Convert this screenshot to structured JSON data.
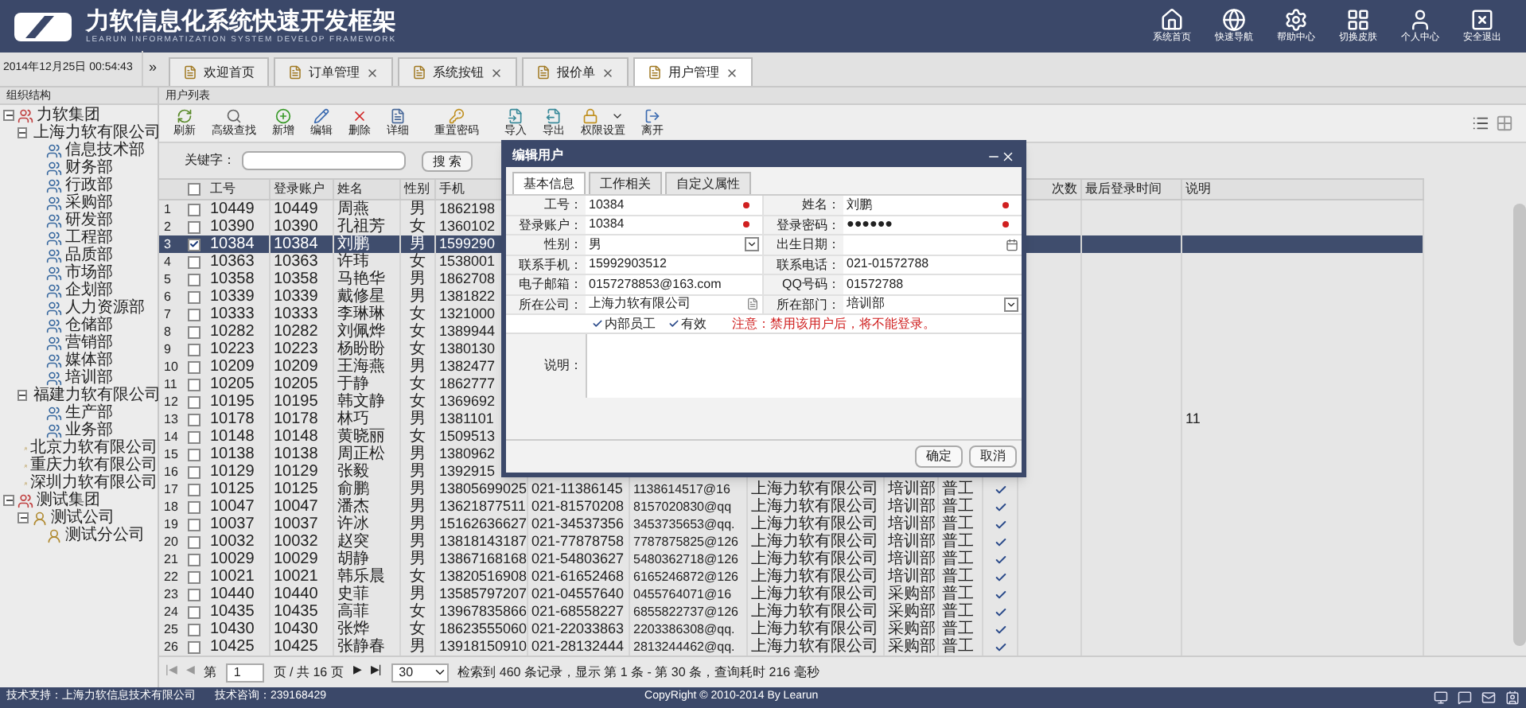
{
  "header": {
    "title": "力软信息化系统快速开发框架",
    "subtitle": "LEARUN INFORMATIZATION SYSTEM DEVELOP FRAMEWORK",
    "nav": [
      "系统首页",
      "快速导航",
      "帮助中心",
      "切换皮肤",
      "个人中心",
      "安全退出"
    ]
  },
  "datetime": "2014年12月25日 00:54:43",
  "tab_more": "»",
  "tabs": [
    {
      "label": "欢迎首页",
      "selected": false,
      "closable": false
    },
    {
      "label": "订单管理",
      "selected": false,
      "closable": true
    },
    {
      "label": "系统按钮",
      "selected": false,
      "closable": true
    },
    {
      "label": "报价单",
      "selected": false,
      "closable": true
    },
    {
      "label": "用户管理",
      "selected": true,
      "closable": true
    }
  ],
  "sidebar": {
    "title": "组织结构",
    "tree": [
      {
        "label": "力软集团",
        "kind": "group",
        "expanded": true,
        "children": [
          {
            "label": "上海力软有限公司",
            "kind": "company",
            "expanded": true,
            "children": [
              {
                "label": "信息技术部",
                "kind": "dept"
              },
              {
                "label": "财务部",
                "kind": "dept"
              },
              {
                "label": "行政部",
                "kind": "dept"
              },
              {
                "label": "采购部",
                "kind": "dept"
              },
              {
                "label": "研发部",
                "kind": "dept"
              },
              {
                "label": "工程部",
                "kind": "dept"
              },
              {
                "label": "品质部",
                "kind": "dept"
              },
              {
                "label": "市场部",
                "kind": "dept"
              },
              {
                "label": "企划部",
                "kind": "dept"
              },
              {
                "label": "人力资源部",
                "kind": "dept"
              },
              {
                "label": "仓储部",
                "kind": "dept"
              },
              {
                "label": "营销部",
                "kind": "dept"
              },
              {
                "label": "媒体部",
                "kind": "dept"
              },
              {
                "label": "培训部",
                "kind": "dept"
              }
            ]
          },
          {
            "label": "福建力软有限公司",
            "kind": "company",
            "expanded": true,
            "children": [
              {
                "label": "生产部",
                "kind": "dept"
              },
              {
                "label": "业务部",
                "kind": "dept"
              }
            ]
          },
          {
            "label": "北京力软有限公司",
            "kind": "company"
          },
          {
            "label": "重庆力软有限公司",
            "kind": "company"
          },
          {
            "label": "深圳力软有限公司",
            "kind": "company"
          }
        ]
      },
      {
        "label": "测试集团",
        "kind": "group",
        "expanded": true,
        "children": [
          {
            "label": "测试公司",
            "kind": "company",
            "expanded": true,
            "children": [
              {
                "label": "测试分公司",
                "kind": "company"
              }
            ]
          }
        ]
      }
    ]
  },
  "panel_title": "用户列表",
  "toolbar": [
    {
      "label": "刷新",
      "dropdown": false
    },
    {
      "label": "高级查找",
      "dropdown": false
    },
    {
      "label": "新增",
      "dropdown": false
    },
    {
      "label": "编辑",
      "dropdown": false
    },
    {
      "label": "删除",
      "dropdown": false
    },
    {
      "label": "详细",
      "dropdown": false
    },
    {
      "label": "重置密码",
      "dropdown": false
    },
    {
      "label": "导入",
      "dropdown": false
    },
    {
      "label": "导出",
      "dropdown": false
    },
    {
      "label": "权限设置",
      "dropdown": true
    },
    {
      "label": "离开",
      "dropdown": false
    }
  ],
  "search": {
    "label": "关键字：",
    "button": "搜 索"
  },
  "table": {
    "select_all": false,
    "columns": [
      "工号",
      "登录账户",
      "姓名",
      "性别",
      "手机"
    ],
    "right_columns": [
      "次数",
      "最后登录时间",
      "说明"
    ],
    "rows": [
      {
        "n": "1",
        "checked": false,
        "selected": false,
        "cells": [
          "10449",
          "10449",
          "周燕",
          "男",
          "1862198"
        ]
      },
      {
        "n": "2",
        "checked": false,
        "selected": false,
        "cells": [
          "10390",
          "10390",
          "孔祖芳",
          "女",
          "1360102"
        ]
      },
      {
        "n": "3",
        "checked": true,
        "selected": true,
        "cells": [
          "10384",
          "10384",
          "刘鹏",
          "男",
          "1599290"
        ]
      },
      {
        "n": "4",
        "checked": false,
        "selected": false,
        "cells": [
          "10363",
          "10363",
          "许玮",
          "女",
          "1538001"
        ]
      },
      {
        "n": "5",
        "checked": false,
        "selected": false,
        "cells": [
          "10358",
          "10358",
          "马艳华",
          "男",
          "1862708"
        ]
      },
      {
        "n": "6",
        "checked": false,
        "selected": false,
        "cells": [
          "10339",
          "10339",
          "戴修星",
          "男",
          "1381822"
        ]
      },
      {
        "n": "7",
        "checked": false,
        "selected": false,
        "cells": [
          "10333",
          "10333",
          "李琳琳",
          "女",
          "1321000"
        ]
      },
      {
        "n": "8",
        "checked": false,
        "selected": false,
        "cells": [
          "10282",
          "10282",
          "刘佩烨",
          "女",
          "1389944"
        ]
      },
      {
        "n": "9",
        "checked": false,
        "selected": false,
        "cells": [
          "10223",
          "10223",
          "杨盼盼",
          "女",
          "1380130"
        ]
      },
      {
        "n": "10",
        "checked": false,
        "selected": false,
        "cells": [
          "10209",
          "10209",
          "王海燕",
          "男",
          "1382477"
        ]
      },
      {
        "n": "11",
        "checked": false,
        "selected": false,
        "cells": [
          "10205",
          "10205",
          "于静",
          "女",
          "1862777"
        ]
      },
      {
        "n": "12",
        "checked": false,
        "selected": false,
        "cells": [
          "10195",
          "10195",
          "韩文静",
          "女",
          "1369692"
        ]
      },
      {
        "n": "13",
        "checked": false,
        "selected": false,
        "cells": [
          "10178",
          "10178",
          "林巧",
          "男",
          "1381101"
        ],
        "note": "11"
      },
      {
        "n": "14",
        "checked": false,
        "selected": false,
        "cells": [
          "10148",
          "10148",
          "黄晓丽",
          "女",
          "1509513"
        ]
      },
      {
        "n": "15",
        "checked": false,
        "selected": false,
        "cells": [
          "10138",
          "10138",
          "周正松",
          "男",
          "1380962"
        ]
      },
      {
        "n": "16",
        "checked": false,
        "selected": false,
        "cells": [
          "10129",
          "10129",
          "张毅",
          "男",
          "1392915"
        ]
      },
      {
        "n": "17",
        "checked": false,
        "selected": false,
        "valid": true,
        "cells": [
          "10125",
          "10125",
          "俞鹏",
          "男",
          "13805699025",
          "021-11386145",
          "1138614517@16",
          "上海力软有限公司",
          "培训部",
          "普工"
        ]
      },
      {
        "n": "18",
        "checked": false,
        "selected": false,
        "valid": true,
        "cells": [
          "10047",
          "10047",
          "潘杰",
          "男",
          "13621877511",
          "021-81570208",
          "8157020830@qq",
          "上海力软有限公司",
          "培训部",
          "普工"
        ]
      },
      {
        "n": "19",
        "checked": false,
        "selected": false,
        "valid": true,
        "cells": [
          "10037",
          "10037",
          "许冰",
          "男",
          "15162636627",
          "021-34537356",
          "3453735653@qq.",
          "上海力软有限公司",
          "培训部",
          "普工"
        ]
      },
      {
        "n": "20",
        "checked": false,
        "selected": false,
        "valid": true,
        "cells": [
          "10032",
          "10032",
          "赵突",
          "男",
          "13818143187",
          "021-77878758",
          "7787875825@126",
          "上海力软有限公司",
          "培训部",
          "普工"
        ]
      },
      {
        "n": "21",
        "checked": false,
        "selected": false,
        "valid": true,
        "cells": [
          "10029",
          "10029",
          "胡静",
          "男",
          "13867168168",
          "021-54803627",
          "5480362718@126",
          "上海力软有限公司",
          "培训部",
          "普工"
        ]
      },
      {
        "n": "22",
        "checked": false,
        "selected": false,
        "valid": true,
        "cells": [
          "10021",
          "10021",
          "韩乐晨",
          "女",
          "13820516908",
          "021-61652468",
          "6165246872@126",
          "上海力软有限公司",
          "培训部",
          "普工"
        ]
      },
      {
        "n": "23",
        "checked": false,
        "selected": false,
        "valid": true,
        "cells": [
          "10440",
          "10440",
          "史菲",
          "男",
          "13585797207",
          "021-04557640",
          "0455764071@16",
          "上海力软有限公司",
          "采购部",
          "普工"
        ]
      },
      {
        "n": "24",
        "checked": false,
        "selected": false,
        "valid": true,
        "cells": [
          "10435",
          "10435",
          "高菲",
          "女",
          "13967835866",
          "021-68558227",
          "6855822737@126",
          "上海力软有限公司",
          "采购部",
          "普工"
        ]
      },
      {
        "n": "25",
        "checked": false,
        "selected": false,
        "valid": true,
        "cells": [
          "10430",
          "10430",
          "张烨",
          "女",
          "18623555060",
          "021-22033863",
          "2203386308@qq.",
          "上海力软有限公司",
          "采购部",
          "普工"
        ]
      },
      {
        "n": "26",
        "checked": false,
        "selected": false,
        "valid": true,
        "cells": [
          "10425",
          "10425",
          "张静春",
          "男",
          "13918150910",
          "021-28132444",
          "2813244462@qq.",
          "上海力软有限公司",
          "采购部",
          "普工"
        ]
      }
    ]
  },
  "pager": {
    "first": "|◀",
    "prev": "◀",
    "before": "第",
    "page": "1",
    "after": "页 / 共 16 页",
    "next": "▶",
    "last": "▶|",
    "size": "30",
    "summary": "检索到 460 条记录，显示 第 1 条 - 第 30 条，查询耗时 216 毫秒"
  },
  "dialog": {
    "title": "编辑用户",
    "tabs": [
      {
        "label": "基本信息",
        "selected": true
      },
      {
        "label": "工作相关",
        "selected": false
      },
      {
        "label": "自定义属性",
        "selected": false
      }
    ],
    "fields": [
      {
        "label": "工号：",
        "value": "10384",
        "kind": "text",
        "required": true
      },
      {
        "label": "姓名：",
        "value": "刘鹏",
        "kind": "text",
        "required": true
      },
      {
        "label": "登录账户：",
        "value": "10384",
        "kind": "text",
        "required": true
      },
      {
        "label": "登录密码：",
        "value": "●●●●●●",
        "kind": "text",
        "required": true
      },
      {
        "label": "性别：",
        "value": "男",
        "kind": "select",
        "required": false
      },
      {
        "label": "出生日期：",
        "kind": "date",
        "required": false
      },
      {
        "label": "联系手机：",
        "value": "15992903512",
        "kind": "text",
        "required": false
      },
      {
        "label": "联系电话：",
        "value": "021-01572788",
        "kind": "text",
        "required": false
      },
      {
        "label": "电子邮箱：",
        "value": "0157278853@163.com",
        "kind": "text",
        "required": false
      },
      {
        "label": "QQ号码：",
        "value": "01572788",
        "kind": "text",
        "required": false
      },
      {
        "label": "所在公司：",
        "value": "上海力软有限公司",
        "kind": "picker",
        "required": false
      },
      {
        "label": "所在部门：",
        "value": "培训部",
        "kind": "select",
        "required": false
      }
    ],
    "checks": [
      {
        "label": "内部员工",
        "checked": true
      },
      {
        "label": "有效",
        "checked": true
      }
    ],
    "warning": "注意：禁用该用户后，将不能登录。",
    "remark_label": "说明：",
    "buttons": [
      "确定",
      "取消"
    ]
  },
  "footer": {
    "support": "技术支持：上海力软信息技术有限公司",
    "contact": "技术咨询：239168429",
    "copyright": "CopyRight © 2010-2014 By Learun"
  }
}
